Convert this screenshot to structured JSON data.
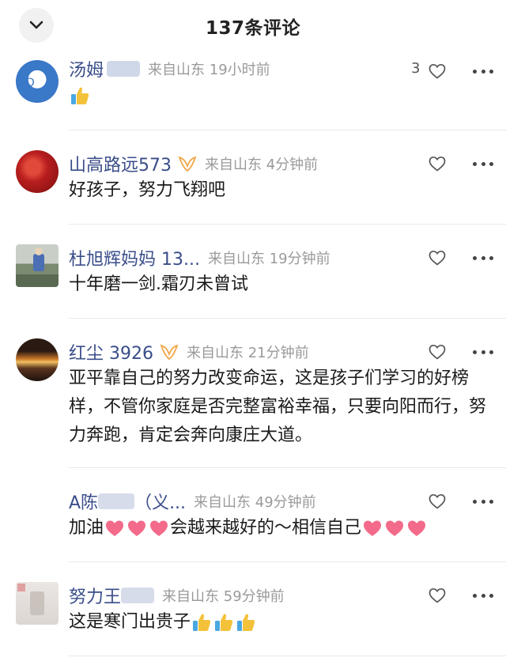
{
  "header": {
    "title": "137条评论",
    "collapse_icon": "chevron-down-icon"
  },
  "colors": {
    "username": "#3a4d8a",
    "meta": "#9a9a9a",
    "vip_gold": "#f0a646",
    "heart": "#f36a8a",
    "thumb": "#f3c23a"
  },
  "comments": [
    {
      "username": "汤姆",
      "location": "来自山东 19小时前",
      "like_count": "3",
      "text": ""
    },
    {
      "username": "山高路远573",
      "location": "来自山东 4分钟前",
      "text": "好孩子，努力飞翔吧"
    },
    {
      "username": "杜旭辉妈妈 13...",
      "location": "来自山东 19分钟前",
      "text": "十年磨一剑.霜刃未曾试"
    },
    {
      "username": "红尘 3926",
      "location": "来自山东 21分钟前",
      "text": "亚平靠自己的努力改变命运，这是孩子们学习的好榜样，不管你家庭是否完整富裕幸福，只要向阳而行，努力奔跑，肯定会奔向康庄大道。"
    },
    {
      "username": "A陈",
      "username_tail": "（义...",
      "location": "来自山东 49分钟前",
      "text_a": "加油",
      "text_b": "会越来越好的～相信自己"
    },
    {
      "username": "努力王",
      "location": "来自山东 59分钟前",
      "text": "这是寒门出贵子"
    }
  ]
}
